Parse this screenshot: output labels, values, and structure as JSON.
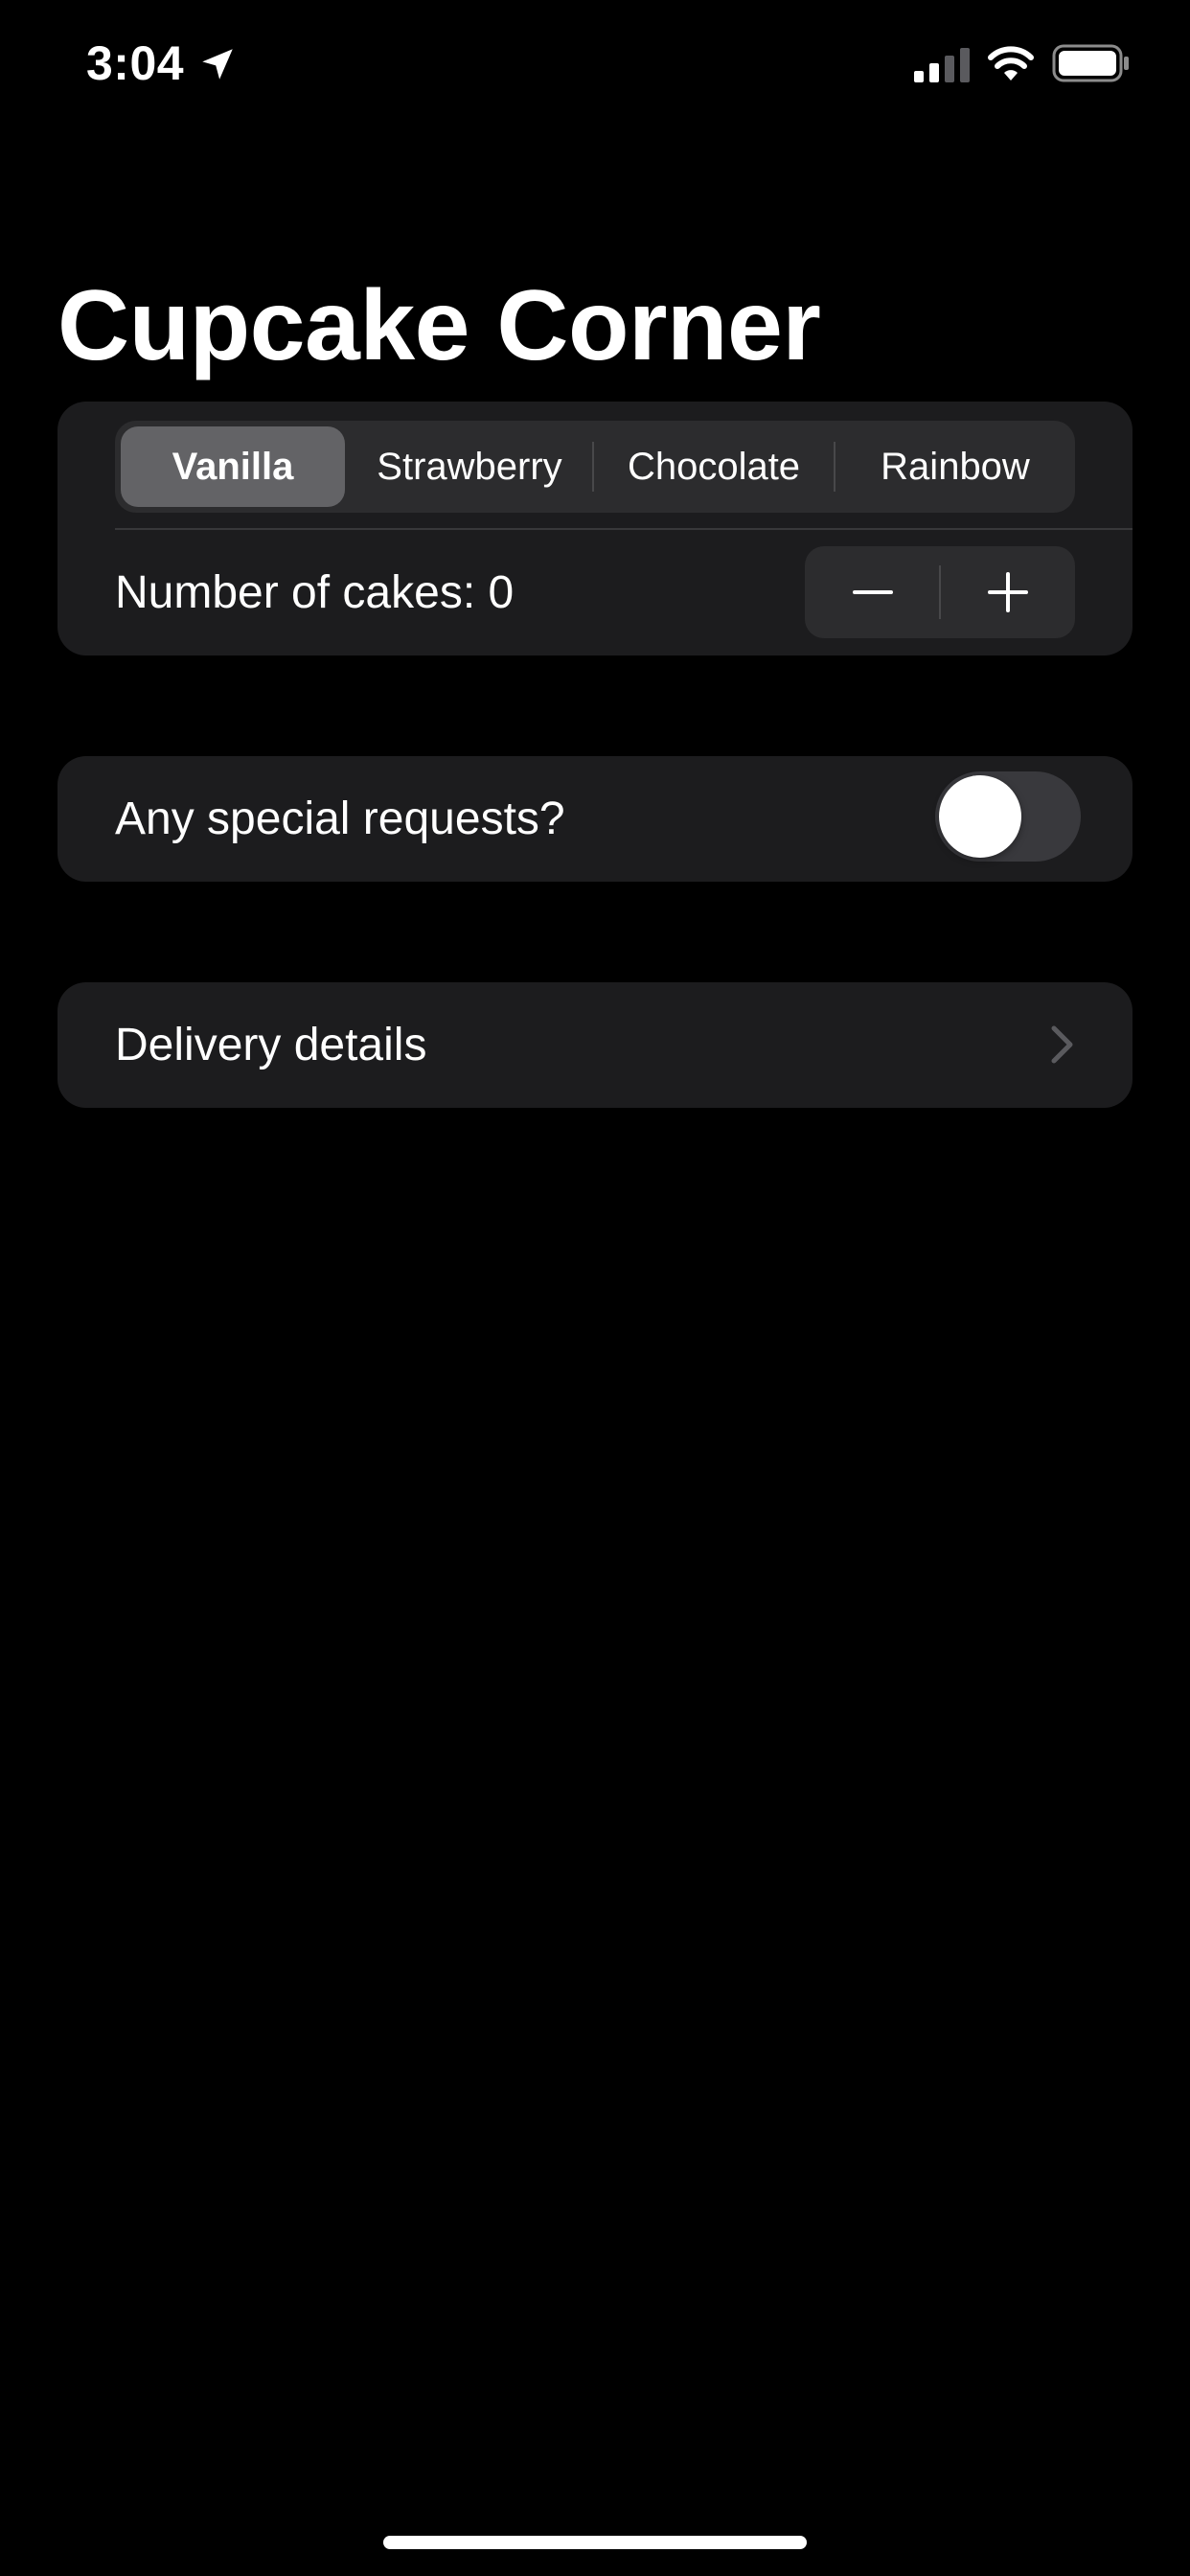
{
  "status_bar": {
    "time": "3:04",
    "icons": [
      "location-arrow-icon",
      "cellular-signal-icon",
      "wifi-icon",
      "battery-icon"
    ]
  },
  "title": "Cupcake Corner",
  "order": {
    "flavors": [
      "Vanilla",
      "Strawberry",
      "Chocolate",
      "Rainbow"
    ],
    "selected_flavor": "Vanilla",
    "quantity_label": "Number of cakes: 0",
    "quantity": 0,
    "stepper": {
      "decrement_icon": "minus-icon",
      "increment_icon": "plus-icon"
    }
  },
  "special": {
    "label": "Any special requests?",
    "enabled": false
  },
  "delivery": {
    "label": "Delivery details",
    "icon": "chevron-right-icon"
  },
  "colors": {
    "background": "#000000",
    "group_background": "#1c1c1e",
    "control_background": "#2c2c2e",
    "selected_segment": "#636366",
    "toggle_off": "#39393d",
    "chevron": "#5a5a5e"
  }
}
